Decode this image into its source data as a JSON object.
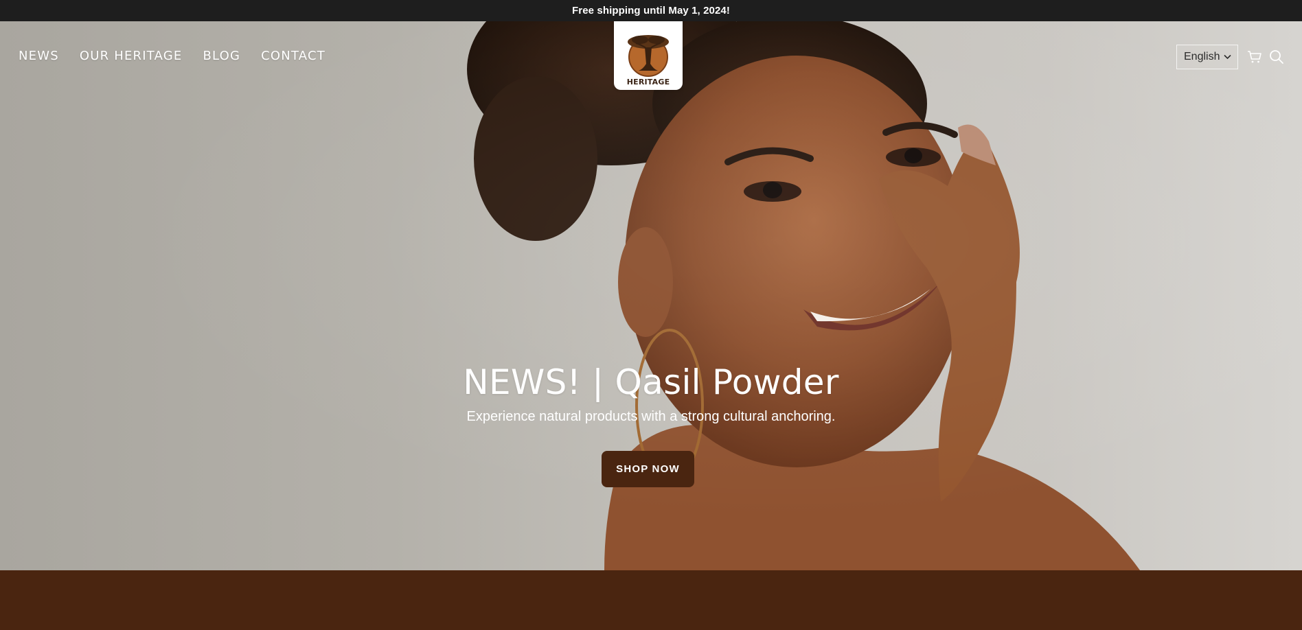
{
  "announcement": {
    "text": "Free shipping until May 1, 2024!"
  },
  "nav": {
    "items": [
      {
        "label": "NEWS"
      },
      {
        "label": "OUR HERITAGE"
      },
      {
        "label": "BLOG"
      },
      {
        "label": "CONTACT"
      }
    ]
  },
  "logo": {
    "text": "HERITAGE",
    "icon": "baobab-tree-icon"
  },
  "header": {
    "language": "English",
    "language_icon": "chevron-down-icon",
    "cart_icon": "cart-icon",
    "search_icon": "search-icon"
  },
  "hero": {
    "title": "NEWS! | Qasil Powder",
    "subtitle": "Experience natural products with a strong cultural anchoring.",
    "cta_label": "SHOP NOW",
    "image": "smiling-woman-portrait"
  },
  "colors": {
    "announcement_bg": "#1e1e1e",
    "brand_brown": "#4a2510",
    "text_light": "#ffffff"
  }
}
